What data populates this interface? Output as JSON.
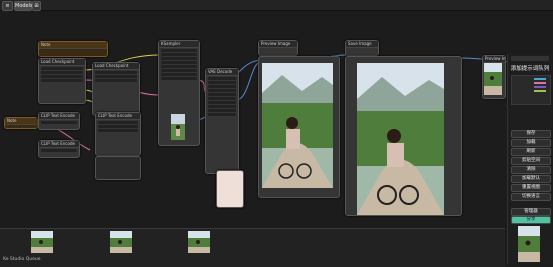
{
  "topbar": {
    "menu_label": "≡",
    "tab_label": "Models",
    "extra_label": "⊞"
  },
  "nodes": {
    "note_title": "Note",
    "note_left_title": "Note",
    "loader_title": "Load Checkpoint",
    "prompt_title": "CLIP Text Encode",
    "sampler_title": "KSampler",
    "decode_title": "VAE Decode",
    "preview1_title": "Preview Image",
    "preview2_title": "Save Image",
    "preview3_title": "Preview Image"
  },
  "right_panel": {
    "title": "添加提示词队列",
    "buttons": [
      "保存",
      "加载",
      "刷新",
      "剪贴空间",
      "清除",
      "加载默认",
      "重置视图",
      "切换语言"
    ],
    "manage_label": "管理器",
    "share_label": "分享"
  },
  "bottom": {
    "status_text": "Ke Studio Queue"
  },
  "colors": {
    "accent": "#46a9c9",
    "share": "#4fc3a1",
    "node_bg": "#353535",
    "note_bg": "#3b2a12"
  },
  "icons": {
    "photo": "portrait-photo",
    "menu": "hamburger-icon"
  }
}
